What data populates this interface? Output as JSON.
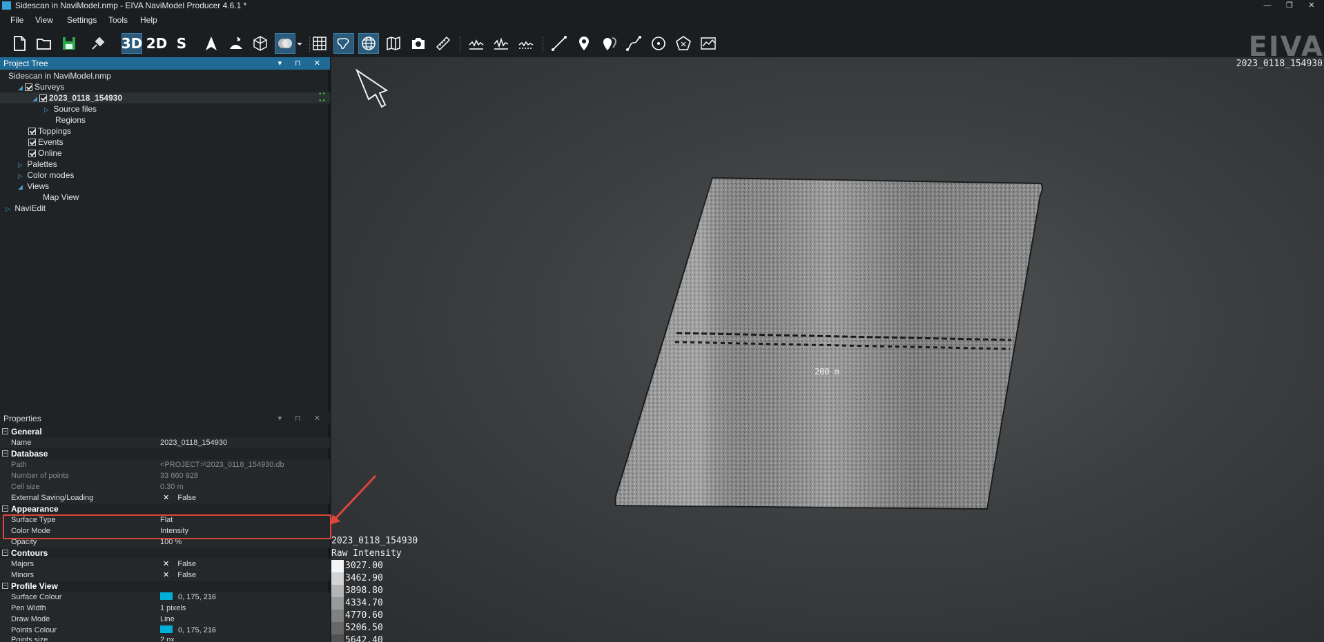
{
  "window": {
    "title": "Sidescan in NaviModel.nmp - EIVA NaviModel Producer 4.6.1 *",
    "minimize": "—",
    "restore": "❐",
    "close": "✕"
  },
  "menu": [
    "File",
    "View",
    "Settings",
    "Tools",
    "Help"
  ],
  "toolbar": {
    "mode_3d": "3D",
    "mode_2d": "2D",
    "mode_s": "S",
    "logo": "EIVA"
  },
  "project_tree": {
    "title": "Project Tree",
    "header_buttons": "▾ ⊓ ✕",
    "items": [
      {
        "label": "Sidescan in NaviModel.nmp"
      },
      {
        "label": "Surveys"
      },
      {
        "label": "2023_0118_154930"
      },
      {
        "label": "Source files"
      },
      {
        "label": "Regions"
      },
      {
        "label": "Toppings"
      },
      {
        "label": "Events"
      },
      {
        "label": "Online"
      },
      {
        "label": "Palettes"
      },
      {
        "label": "Color modes"
      },
      {
        "label": "Views"
      },
      {
        "label": "Map View"
      },
      {
        "label": "NaviEdit"
      }
    ]
  },
  "properties": {
    "title": "Properties",
    "header_buttons": "▾ ⊓ ✕",
    "categories": {
      "general": "General",
      "database": "Database",
      "appearance": "Appearance",
      "contours": "Contours",
      "profile_view": "Profile View"
    },
    "rows": {
      "name": {
        "key": "Name",
        "value": "2023_0118_154930"
      },
      "path": {
        "key": "Path",
        "value": "<PROJECT>\\2023_0118_154930.db"
      },
      "num_points": {
        "key": "Number of points",
        "value": "33 660 928"
      },
      "cell_size": {
        "key": "Cell size",
        "value": "0.30 m"
      },
      "external_saving": {
        "key": "External Saving/Loading",
        "value": "False"
      },
      "surface_type": {
        "key": "Surface Type",
        "value": "Flat"
      },
      "color_mode": {
        "key": "Color Mode",
        "value": "Intensity"
      },
      "opacity": {
        "key": "Opacity",
        "value": "100 %"
      },
      "majors": {
        "key": "Majors",
        "value": "False"
      },
      "minors": {
        "key": "Minors",
        "value": "False"
      },
      "surface_colour": {
        "key": "Surface Colour",
        "value": "0, 175, 216"
      },
      "pen_width": {
        "key": "Pen Width",
        "value": "1 pixels"
      },
      "draw_mode": {
        "key": "Draw Mode",
        "value": "Line"
      },
      "points_colour": {
        "key": "Points Colour",
        "value": "0, 175, 216"
      },
      "points_size": {
        "key": "Points size",
        "value": "2 px"
      }
    },
    "accent_color": "#00afd8"
  },
  "viewport": {
    "corner_label": "2023_0118_154930",
    "scale_label": "200 m",
    "legend": {
      "survey": "2023_0118_154930",
      "title": "Raw Intensity",
      "values": [
        "3027.00",
        "3462.90",
        "3898.80",
        "4334.70",
        "4770.60",
        "5206.50",
        "5642.40"
      ]
    }
  },
  "annotation": {
    "color": "#e0453a"
  }
}
